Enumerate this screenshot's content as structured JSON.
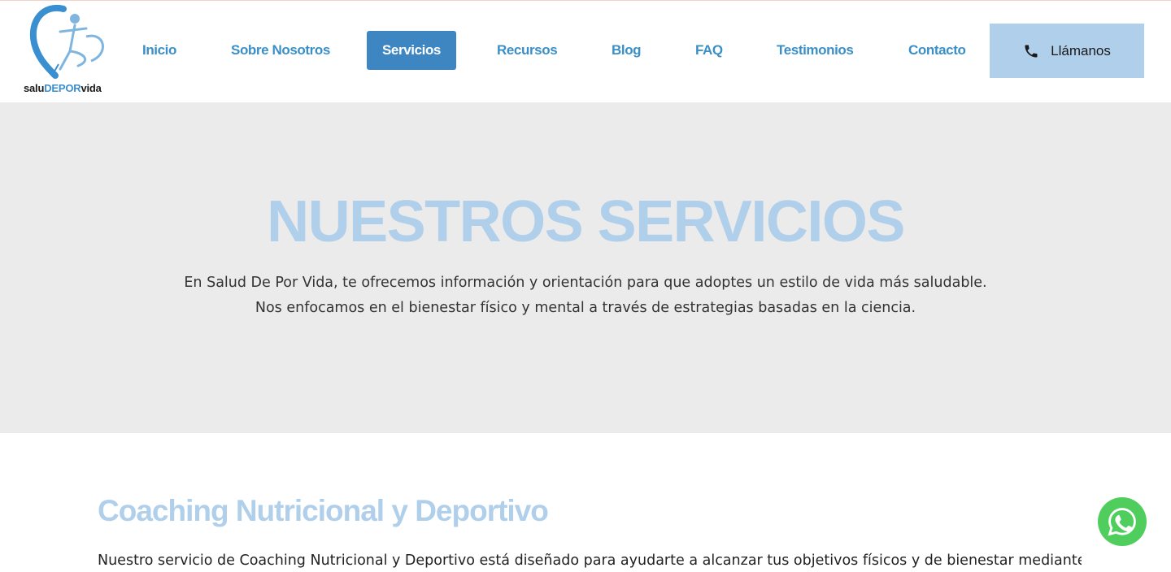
{
  "brand": {
    "logo_text_start": "salu",
    "logo_text_mid": "DEPOR",
    "logo_text_end": "vida",
    "icon": "runner-heart-logo"
  },
  "nav": {
    "items": [
      {
        "label": "Inicio"
      },
      {
        "label": "Sobre Nosotros"
      },
      {
        "label": "Servicios",
        "active": true
      },
      {
        "label": "Recursos"
      },
      {
        "label": "Blog"
      },
      {
        "label": "FAQ"
      },
      {
        "label": "Testimonios"
      },
      {
        "label": "Contacto"
      }
    ],
    "call_button": {
      "label": "Llámanos",
      "icon": "phone-icon"
    }
  },
  "hero": {
    "title": "NUESTROS SERVICIOS",
    "text": "En Salud De Por Vida, te ofrecemos información y orientación para que adoptes un estilo de vida más saludable. Nos enfocamos en el bienestar físico y mental a través de estrategias basadas en la ciencia."
  },
  "section": {
    "title": "Coaching Nutricional y Deportivo",
    "text": "Nuestro servicio de Coaching Nutricional y Deportivo está diseñado para ayudarte a alcanzar tus objetivos físicos y de bienestar mediante un"
  },
  "floating": {
    "icon": "whatsapp-icon"
  },
  "colors": {
    "accent": "#3d86c1",
    "nav_text": "#3a8fc7",
    "light_blue": "#b0cfeb",
    "hero_bg": "#ebebeb",
    "whatsapp": "#4fce5d"
  }
}
